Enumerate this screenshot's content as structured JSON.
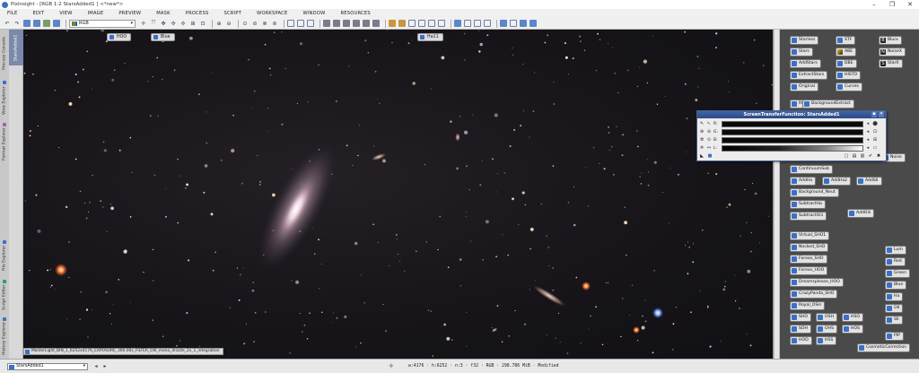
{
  "window": {
    "title": "PixInsight - [RGB 1:2 StarsAdded1 ] <*new*>",
    "minimize": "–",
    "maximize": "❐",
    "close": "✕"
  },
  "menu": [
    "FILE",
    "EDIT",
    "VIEW",
    "IMAGE",
    "PREVIEW",
    "MASK",
    "PROCESS",
    "SCRIPT",
    "WORKSPACE",
    "WINDOW",
    "RESOURCES"
  ],
  "toolbar": {
    "channel_value": "RGB"
  },
  "left_tabs": [
    "Process Console",
    "View Explorer",
    "Format Explorer",
    "File Explorer",
    "Script Editor",
    "History Explorer"
  ],
  "view_tab": "StarsAdded1",
  "image_tags": [
    {
      "label": "HOO"
    },
    {
      "label": "Blue"
    },
    {
      "label": "Ha11"
    }
  ],
  "file_tag": "MasterLight_BIN_1_6252x4176_EXPOSURE_300.00s_FILTER_OIII_mono_drizzle_2x_1_integration",
  "process_icons": [
    {
      "label": "StarlessAO",
      "text": "Starless"
    },
    {
      "label": "STF"
    },
    {
      "label": "Blurx",
      "icon": "B"
    },
    {
      "label": "Stars"
    },
    {
      "label": "ABE"
    },
    {
      "label": "NoiseX",
      "icon": "N"
    },
    {
      "label": "AddStars"
    },
    {
      "label": "DBE"
    },
    {
      "label": "StarX",
      "icon": "S"
    },
    {
      "label": "ExtractStars"
    },
    {
      "label": "HISTO"
    },
    {
      "label": "Original"
    },
    {
      "label": "Curves"
    },
    {
      "label": "RGB"
    },
    {
      "label": "BackgroundExtract"
    },
    {
      "label": "Noise"
    },
    {
      "label": "ContinuumSub"
    },
    {
      "label": "AddHa"
    },
    {
      "label": "AddHa2"
    },
    {
      "label": "AddSII"
    },
    {
      "label": "Background_Neut"
    },
    {
      "label": "SubtractHa"
    },
    {
      "label": "SubtractOiii"
    },
    {
      "label": "AddOiii"
    },
    {
      "label": "Virtual_SHO1"
    },
    {
      "label": "Nocked_SHO"
    },
    {
      "label": "Lum"
    },
    {
      "label": "Forexx_SHO"
    },
    {
      "label": "Red"
    },
    {
      "label": "Forexx_HOO"
    },
    {
      "label": "Green"
    },
    {
      "label": "Dreamsplease_HOO"
    },
    {
      "label": "Blue"
    },
    {
      "label": "CrazyPanda_SHO"
    },
    {
      "label": "Ha"
    },
    {
      "label": "Royal_OSH"
    },
    {
      "label": "OII"
    },
    {
      "label": "SHO"
    },
    {
      "label": "OSH"
    },
    {
      "label": "HSO"
    },
    {
      "label": "SII"
    },
    {
      "label": "SOH"
    },
    {
      "label": "OHS"
    },
    {
      "label": "HOS"
    },
    {
      "label": "HOO"
    },
    {
      "label": "HSS"
    },
    {
      "label": "PIP"
    },
    {
      "label": "CosmeticCorrection"
    }
  ],
  "stf": {
    "title": "ScreenTransferFunction: StarsAdded1",
    "rows": [
      {
        "label": "R:"
      },
      {
        "label": "G:"
      },
      {
        "label": "B:"
      },
      {
        "label": "L:"
      }
    ]
  },
  "status": {
    "view_value": "StarsAdded1",
    "text": "w:4176 · h:6252 · n:3 · f32 · RGB · 298.786 MiB · Modified"
  },
  "colors": {
    "panel_bg": "#4a4a4a",
    "stf_header": "#3f64a8",
    "icon_blue": "#3c6fc6"
  }
}
